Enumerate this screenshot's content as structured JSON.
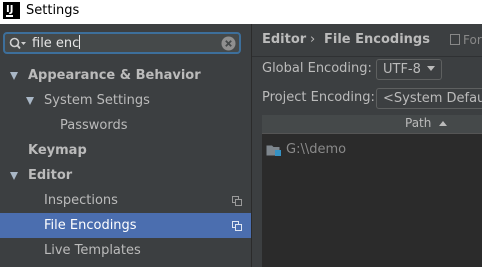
{
  "window": {
    "title": "Settings",
    "app_icon_letter": "IJ"
  },
  "search": {
    "value": "file enc"
  },
  "tree": [
    {
      "label": "Appearance & Behavior",
      "bold": true,
      "expanded": true
    },
    {
      "label": "System Settings",
      "bold": false,
      "expanded": true
    },
    {
      "label": "Passwords",
      "bold": false
    },
    {
      "label": "Keymap",
      "bold": true
    },
    {
      "label": "Editor",
      "bold": true,
      "expanded": true
    },
    {
      "label": "Inspections",
      "bold": false
    },
    {
      "label": "File Encodings",
      "bold": false,
      "selected": true
    },
    {
      "label": "Live Templates",
      "bold": false
    }
  ],
  "breadcrumb": {
    "parent": "Editor",
    "separator": "›",
    "current": "File Encodings",
    "scope": "For"
  },
  "form": {
    "global_encoding_label": "Global Encoding:",
    "global_encoding_value": "UTF-8",
    "project_encoding_label": "Project Encoding:",
    "project_encoding_value": "<System Default: GBK>"
  },
  "table": {
    "column_path": "Path",
    "rows": [
      {
        "path": "G:\\\\demo"
      }
    ]
  },
  "colors": {
    "selection": "#4b6eaf",
    "search_border": "#3d6f9b",
    "background": "#3c3f41"
  }
}
